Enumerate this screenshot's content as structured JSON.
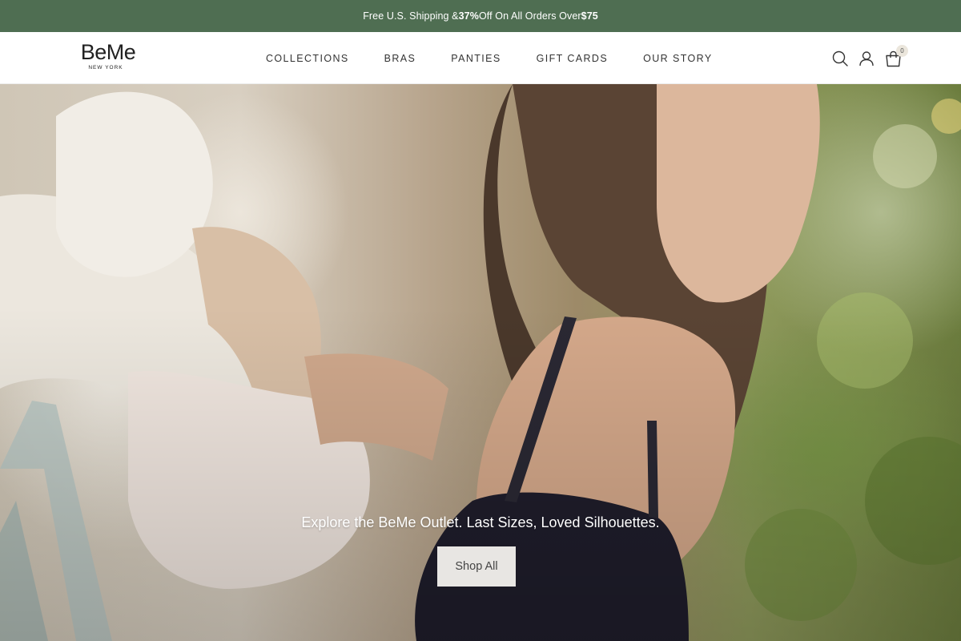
{
  "announcement": {
    "prefix": "Free U.S. Shipping & ",
    "discount": "37%",
    "middle": " Off On All Orders Over ",
    "threshold": "$75"
  },
  "header": {
    "logo_main": "BeMe",
    "logo_sub": "NEW YORK",
    "nav": [
      "COLLECTIONS",
      "BRAS",
      "PANTIES",
      "GIFT CARDS",
      "OUR STORY"
    ],
    "icons": [
      "search-icon",
      "account-icon",
      "shopping-bag-icon"
    ],
    "cart_count": "0"
  },
  "hero": {
    "caption": "Explore the BeMe Outlet. Last Sizes, Loved Silhouettes.",
    "button_label": "Shop All"
  },
  "colors": {
    "announcement_bg": "#4f6e52",
    "button_bg": "#e8e6e3"
  }
}
